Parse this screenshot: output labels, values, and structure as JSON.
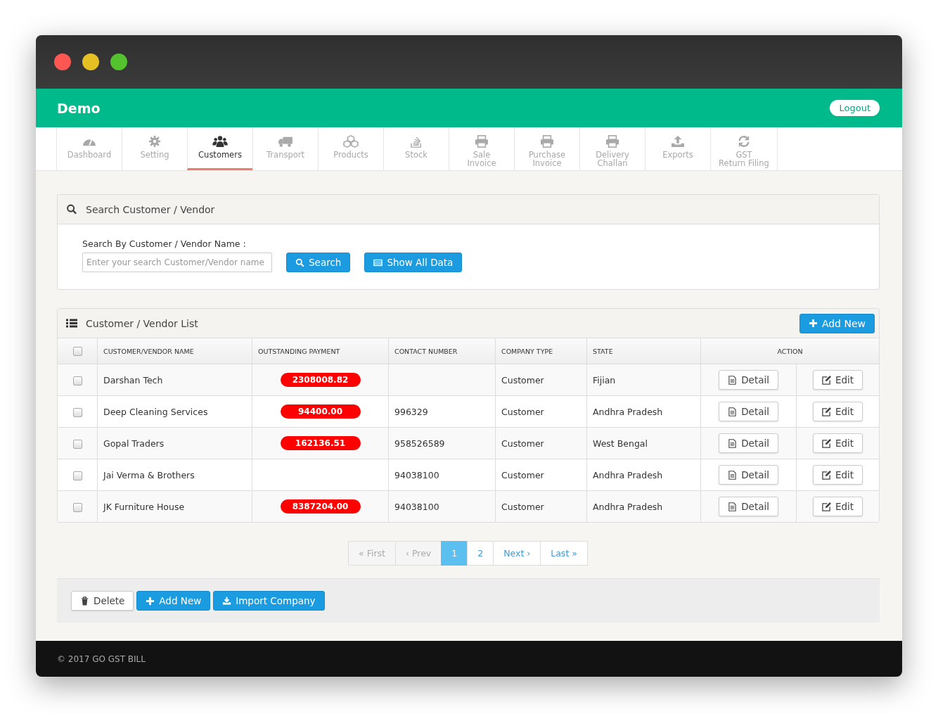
{
  "app": {
    "title": "Demo",
    "logout": "Logout"
  },
  "nav": [
    {
      "lines": [
        "Dashboard"
      ],
      "selected": false
    },
    {
      "lines": [
        "Setting"
      ],
      "selected": false
    },
    {
      "lines": [
        "Customers"
      ],
      "selected": true
    },
    {
      "lines": [
        "Transport"
      ],
      "selected": false
    },
    {
      "lines": [
        "Products"
      ],
      "selected": false
    },
    {
      "lines": [
        "Stock"
      ],
      "selected": false
    },
    {
      "lines": [
        "Sale",
        "Invoice"
      ],
      "selected": false
    },
    {
      "lines": [
        "Purchase",
        "Invoice"
      ],
      "selected": false
    },
    {
      "lines": [
        "Delivery",
        "Challan"
      ],
      "selected": false
    },
    {
      "lines": [
        "Exports"
      ],
      "selected": false
    },
    {
      "lines": [
        "GST",
        "Return Filing"
      ],
      "selected": false
    }
  ],
  "search_panel": {
    "title": "Search Customer / Vendor",
    "label": "Search By Customer / Vendor Name :",
    "placeholder": "Enter your search Customer/Vendor name",
    "search_button": "Search",
    "show_all_button": "Show All Data"
  },
  "list_panel": {
    "title": "Customer / Vendor List",
    "add_button": "Add New",
    "columns": [
      "CUSTOMER/VENDOR NAME",
      "OUTSTANDING PAYMENT",
      "CONTACT NUMBER",
      "COMPANY TYPE",
      "STATE",
      "ACTION"
    ],
    "header_checked": false,
    "rows": [
      {
        "checked": false,
        "name": "Darshan Tech",
        "payment": "2308008.82",
        "contact": "",
        "type": "Customer",
        "state": "Fijian",
        "detail": "Detail",
        "edit": "Edit"
      },
      {
        "checked": false,
        "name": "Deep Cleaning Services",
        "payment": "94400.00",
        "contact": "996329",
        "type": "Customer",
        "state": "Andhra Pradesh",
        "detail": "Detail",
        "edit": "Edit"
      },
      {
        "checked": false,
        "name": "Gopal Traders",
        "payment": "162136.51",
        "contact": "958526589",
        "type": "Customer",
        "state": "West Bengal",
        "detail": "Detail",
        "edit": "Edit"
      },
      {
        "checked": false,
        "name": "Jai Verma & Brothers",
        "contact": "94038100",
        "type": "Customer",
        "state": "Andhra Pradesh",
        "detail": "Detail",
        "edit": "Edit"
      },
      {
        "checked": false,
        "name": "JK Furniture House",
        "payment": "8387204.00",
        "contact": "94038100",
        "type": "Customer",
        "state": "Andhra Pradesh",
        "detail": "Detail",
        "edit": "Edit"
      }
    ]
  },
  "pagination": [
    {
      "label": "« First",
      "selected": false,
      "disabled": true
    },
    {
      "label": "‹ Prev",
      "selected": false,
      "disabled": true
    },
    {
      "label": "1",
      "selected": true,
      "disabled": false
    },
    {
      "label": "2",
      "selected": false,
      "disabled": false
    },
    {
      "label": "Next ›",
      "selected": false,
      "disabled": false
    },
    {
      "label": "Last »",
      "selected": false,
      "disabled": false
    }
  ],
  "actions": {
    "delete": "Delete",
    "add_new": "Add New",
    "import": "Import Company"
  },
  "footer": "© 2017 GO GST BILL"
}
